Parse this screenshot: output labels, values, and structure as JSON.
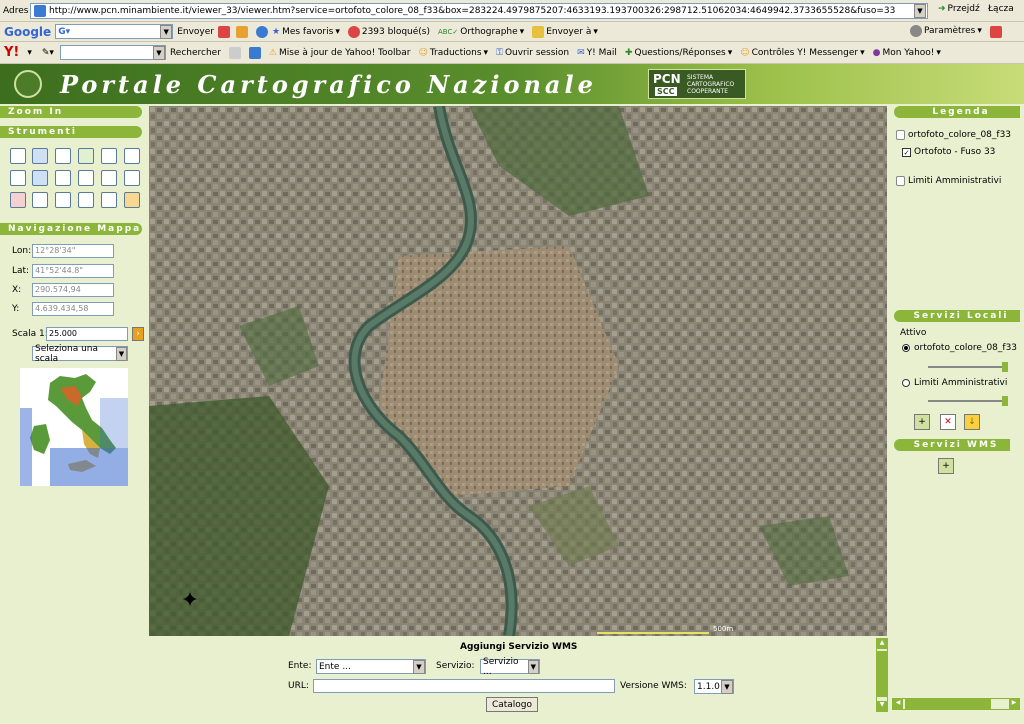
{
  "browser": {
    "address_label": "Adres",
    "url": "http://www.pcn.minambiente.it/viewer_33/viewer.htm?service=ortofoto_colore_08_f33&box=283224.4979875207:4633193.193700326:298712.51062034:4649942.3733655528&fuso=33",
    "go_label": "Przejdź",
    "links_label": "Łącza",
    "google": {
      "logo": "Google",
      "search_label": "Envoyer",
      "favorites_label": "Mes favoris",
      "blocked_label": "2393 bloqué(s)",
      "spelling_label": "Orthographe",
      "send_label": "Envoyer à",
      "settings_label": "Paramètres"
    },
    "yahoo": {
      "logo": "Y!",
      "search_label": "Rechercher",
      "update_label": "Mise à jour de Yahoo! Toolbar",
      "translate_label": "Traductions",
      "session_label": "Ouvrir session",
      "mail_label": "Y! Mail",
      "answers_label": "Questions/Réponses",
      "messenger_label": "Contrôles Y! Messenger",
      "myyahoo_label": "Mon Yahoo!"
    }
  },
  "app": {
    "title": "Portale Cartografico Nazionale",
    "logo_text": "PCN",
    "logo_sub": "SISTEMA CARTOGRAFICO COOPERANTE",
    "logo_badge": "SCC"
  },
  "left_panel": {
    "zoom_header": "Zoom In",
    "tools_header": "Strumenti",
    "nav_header": "Navigazione Mappa",
    "lon_label": "Lon:",
    "lon_value": "12°28'34\"",
    "lat_label": "Lat:",
    "lat_value": "41°52'44.8\"",
    "x_label": "X:",
    "x_value": "290.574,94",
    "y_label": "Y:",
    "y_value": "4.639.434,58",
    "scale_label": "Scala 1:",
    "scale_value": "25.000",
    "scale_select": "Seleziona una scala"
  },
  "right_panel": {
    "legend_header": "Legenda",
    "legend_items": [
      "ortofoto_colore_08_f33",
      "Ortofoto - Fuso 33",
      "Limiti Amministrativi"
    ],
    "local_header": "Servizi Locali",
    "active_label": "Attivo",
    "local_items": [
      "ortofoto_colore_08_f33",
      "Limiti Amministrativi"
    ],
    "wms_header": "Servizi WMS"
  },
  "wms_form": {
    "title": "Aggiungi Servizio WMS",
    "ente_label": "Ente:",
    "ente_value": "Ente ...",
    "servizio_label": "Servizio:",
    "servizio_value": "Servizio ...",
    "url_label": "URL:",
    "url_value": "",
    "version_label": "Versione WMS:",
    "version_value": "1.1.0",
    "catalog_button": "Catalogo"
  },
  "map": {
    "scale_text": "500m"
  },
  "colors": {
    "panel_header": "#8bb63a",
    "page_background": "#e8f0d0",
    "header_dark": "#3c6e1e"
  }
}
